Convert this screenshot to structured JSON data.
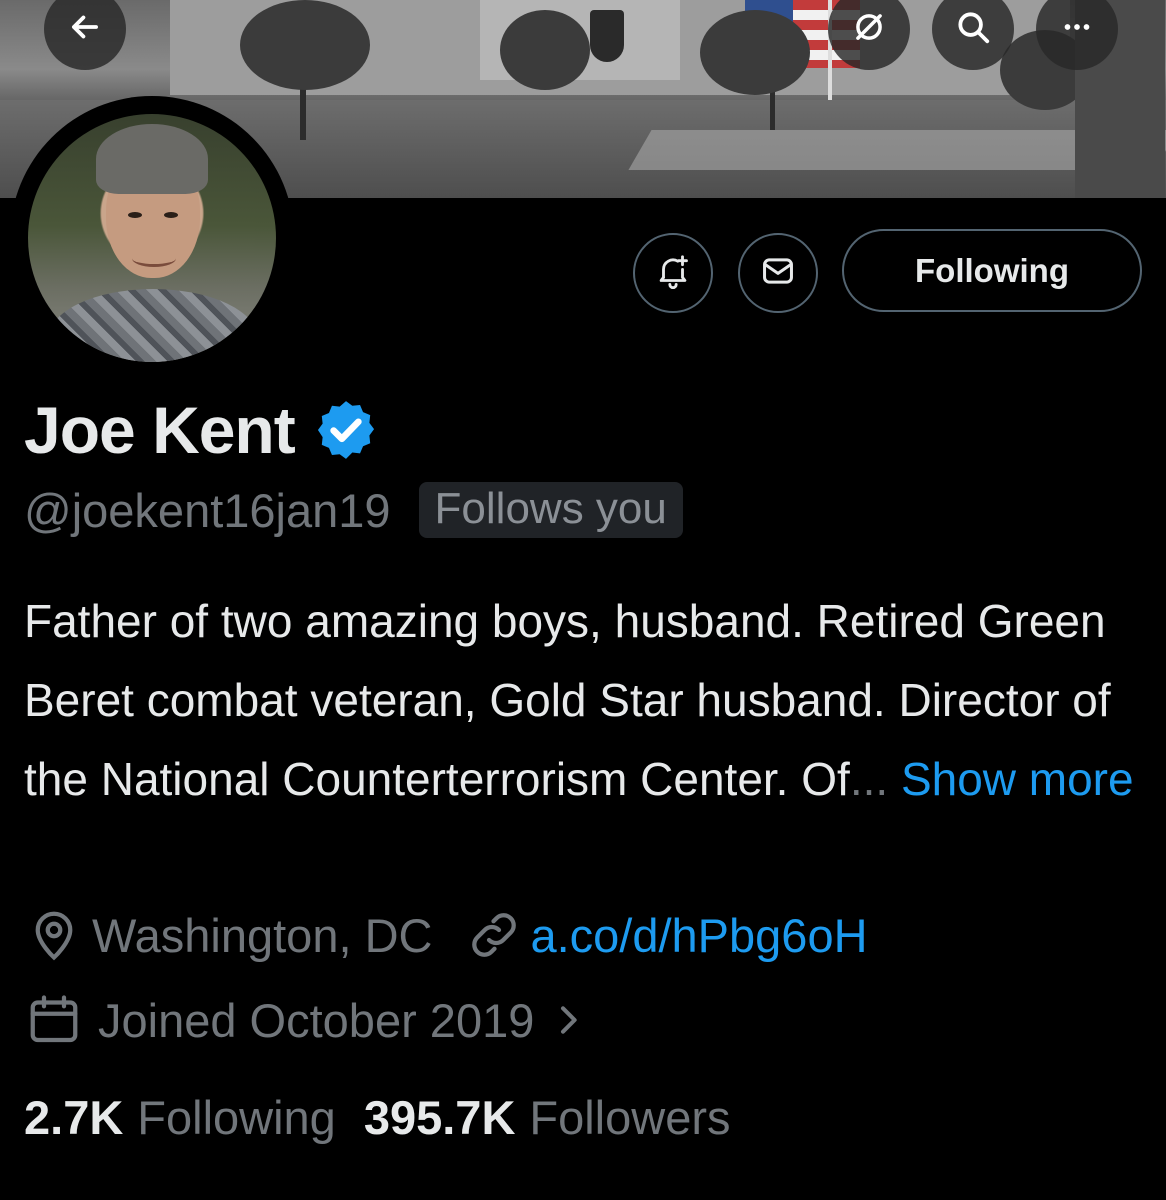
{
  "header": {
    "back_icon": "arrow-left-icon",
    "grok_icon": "slash-circle-icon",
    "search_icon": "search-icon",
    "more_icon": "more-dots-icon"
  },
  "actions": {
    "notify_icon": "bell-plus-icon",
    "message_icon": "envelope-icon",
    "following_label": "Following"
  },
  "profile": {
    "name": "Joe Kent",
    "handle": "@joekent16jan19",
    "follows_you": "Follows you",
    "bio_text": "Father of two amazing boys, husband. Retired Green Beret combat veteran, Gold Star husband. Director of the National Counterterrorism Center. Of",
    "bio_ellipsis": "...",
    "show_more": "Show more",
    "location": "Washington, DC",
    "link": "a.co/d/hPbg6oH",
    "joined": "Joined October 2019",
    "following_count": "2.7K",
    "following_label": "Following",
    "followers_count": "395.7K",
    "followers_label": "Followers"
  },
  "colors": {
    "background": "#000000",
    "accent": "#1d9bf0",
    "muted": "#71767b",
    "verified": "#1d9bf0"
  }
}
